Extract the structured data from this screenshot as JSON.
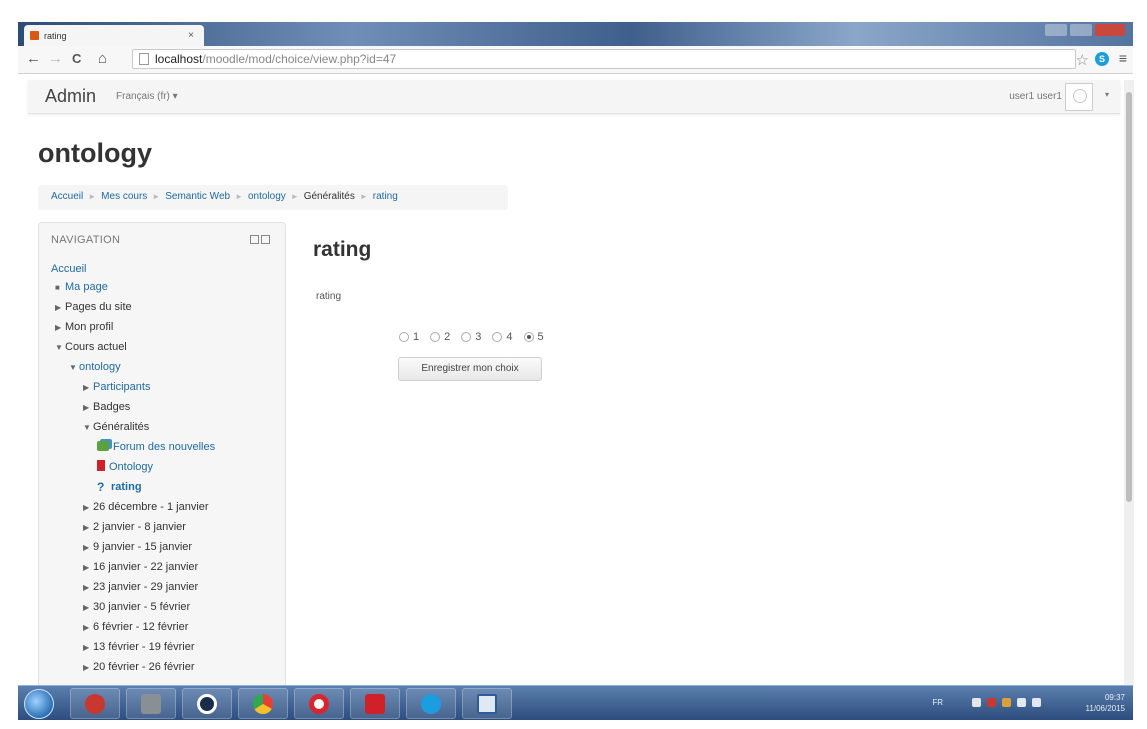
{
  "browser": {
    "tab_title": "rating",
    "tab_close": "×",
    "back": "←",
    "forward": "→",
    "reload": "C",
    "home": "⌂",
    "url_host": "localhost",
    "url_path": "/moodle/mod/choice/view.php?id=47",
    "bookmark_star": "☆",
    "ext_label": "S",
    "menu": "≡"
  },
  "header": {
    "brand": "Admin",
    "language": "Français (fr) ▾",
    "user": "user1 user1",
    "user_caret": "▾"
  },
  "course_title": "ontology",
  "breadcrumb": [
    "Accueil",
    "Mes cours",
    "Semantic Web",
    "ontology",
    "Généralités",
    "rating"
  ],
  "breadcrumb_sep": "►",
  "navigation": {
    "title": "NAVIGATION",
    "items": [
      {
        "label": "Accueil",
        "marker": ""
      },
      {
        "label": "Ma page",
        "marker": "■"
      },
      {
        "label": "Pages du site",
        "marker": "▶"
      },
      {
        "label": "Mon profil",
        "marker": "▶"
      },
      {
        "label": "Cours actuel",
        "marker": "▼"
      },
      {
        "label": "ontology",
        "marker": "▼"
      },
      {
        "label": "Participants",
        "marker": "▶"
      },
      {
        "label": "Badges",
        "marker": "▶"
      },
      {
        "label": "Généralités",
        "marker": "▼"
      },
      {
        "label": "Forum des nouvelles",
        "icon": "forum-icon"
      },
      {
        "label": "Ontology",
        "icon": "pdf-icon"
      },
      {
        "label": "rating",
        "icon": "choice-icon",
        "icon_glyph": "?"
      },
      {
        "label": "26 décembre - 1 janvier",
        "marker": "▶"
      },
      {
        "label": "2 janvier - 8 janvier",
        "marker": "▶"
      },
      {
        "label": "9 janvier - 15 janvier",
        "marker": "▶"
      },
      {
        "label": "16 janvier - 22 janvier",
        "marker": "▶"
      },
      {
        "label": "23 janvier - 29 janvier",
        "marker": "▶"
      },
      {
        "label": "30 janvier - 5 février",
        "marker": "▶"
      },
      {
        "label": "6 février - 12 février",
        "marker": "▶"
      },
      {
        "label": "13 février - 19 février",
        "marker": "▶"
      },
      {
        "label": "20 février - 26 février",
        "marker": "▶"
      }
    ]
  },
  "main": {
    "title": "rating",
    "intro": "rating",
    "options": [
      "1",
      "2",
      "3",
      "4",
      "5"
    ],
    "selected_option": "5",
    "submit_label": "Enregistrer mon choix"
  },
  "taskbar": {
    "language": "FR",
    "time": "09:37",
    "date": "11/06/2015",
    "apps": [
      "skype-security-icon",
      "camera-icon",
      "media-player-icon",
      "chrome-icon",
      "opera-icon",
      "acrobat-icon",
      "skype-icon",
      "window-icon"
    ]
  },
  "colors": {
    "link": "#1f6aa5",
    "taskbar": "#2c4d7d",
    "pdf_red": "#d0202a"
  }
}
